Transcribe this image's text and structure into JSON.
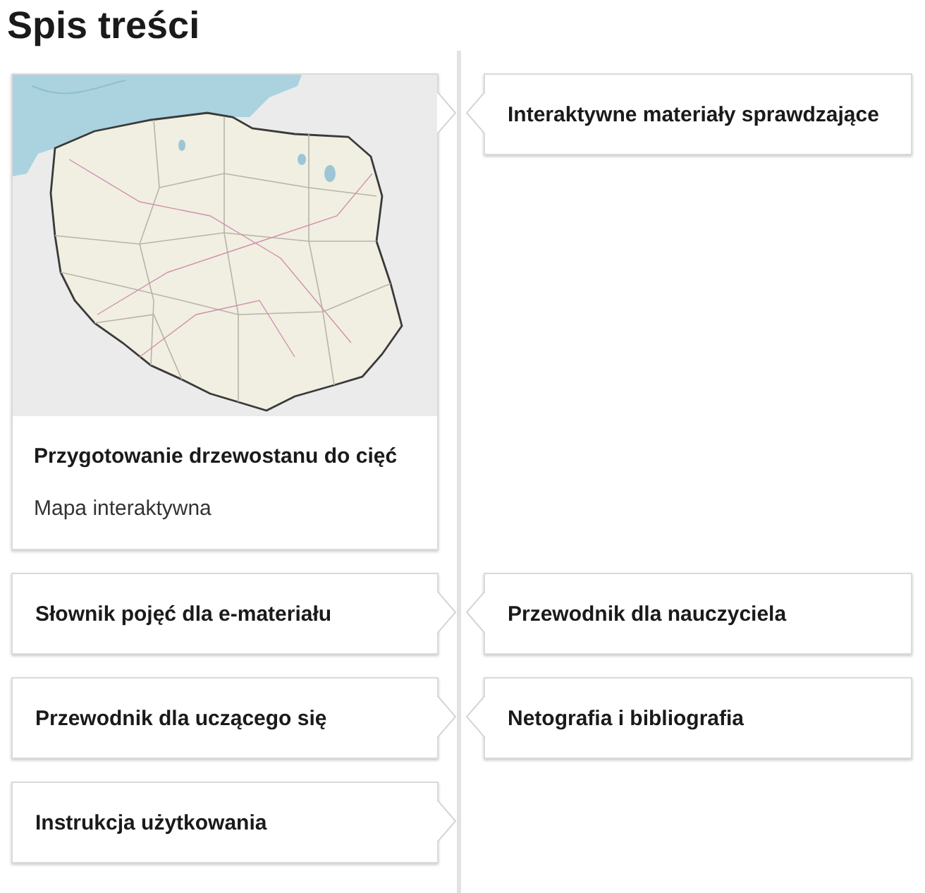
{
  "title": "Spis treści",
  "rows": [
    {
      "left": {
        "kind": "map_card",
        "title": "Przygotowanie drzewostanu do cięć",
        "subtitle": "Mapa interaktywna"
      },
      "right": {
        "kind": "link",
        "title": "Interaktywne materiały sprawdzające"
      }
    },
    {
      "left": {
        "kind": "link",
        "title": "Słownik pojęć dla e-materiału"
      },
      "right": {
        "kind": "link",
        "title": "Przewodnik dla nauczyciela"
      }
    },
    {
      "left": {
        "kind": "link",
        "title": "Przewodnik dla uczącego się"
      },
      "right": {
        "kind": "link",
        "title": "Netografia i bibliografia"
      }
    },
    {
      "left": {
        "kind": "link",
        "title": "Instrukcja użytkowania"
      }
    }
  ]
}
